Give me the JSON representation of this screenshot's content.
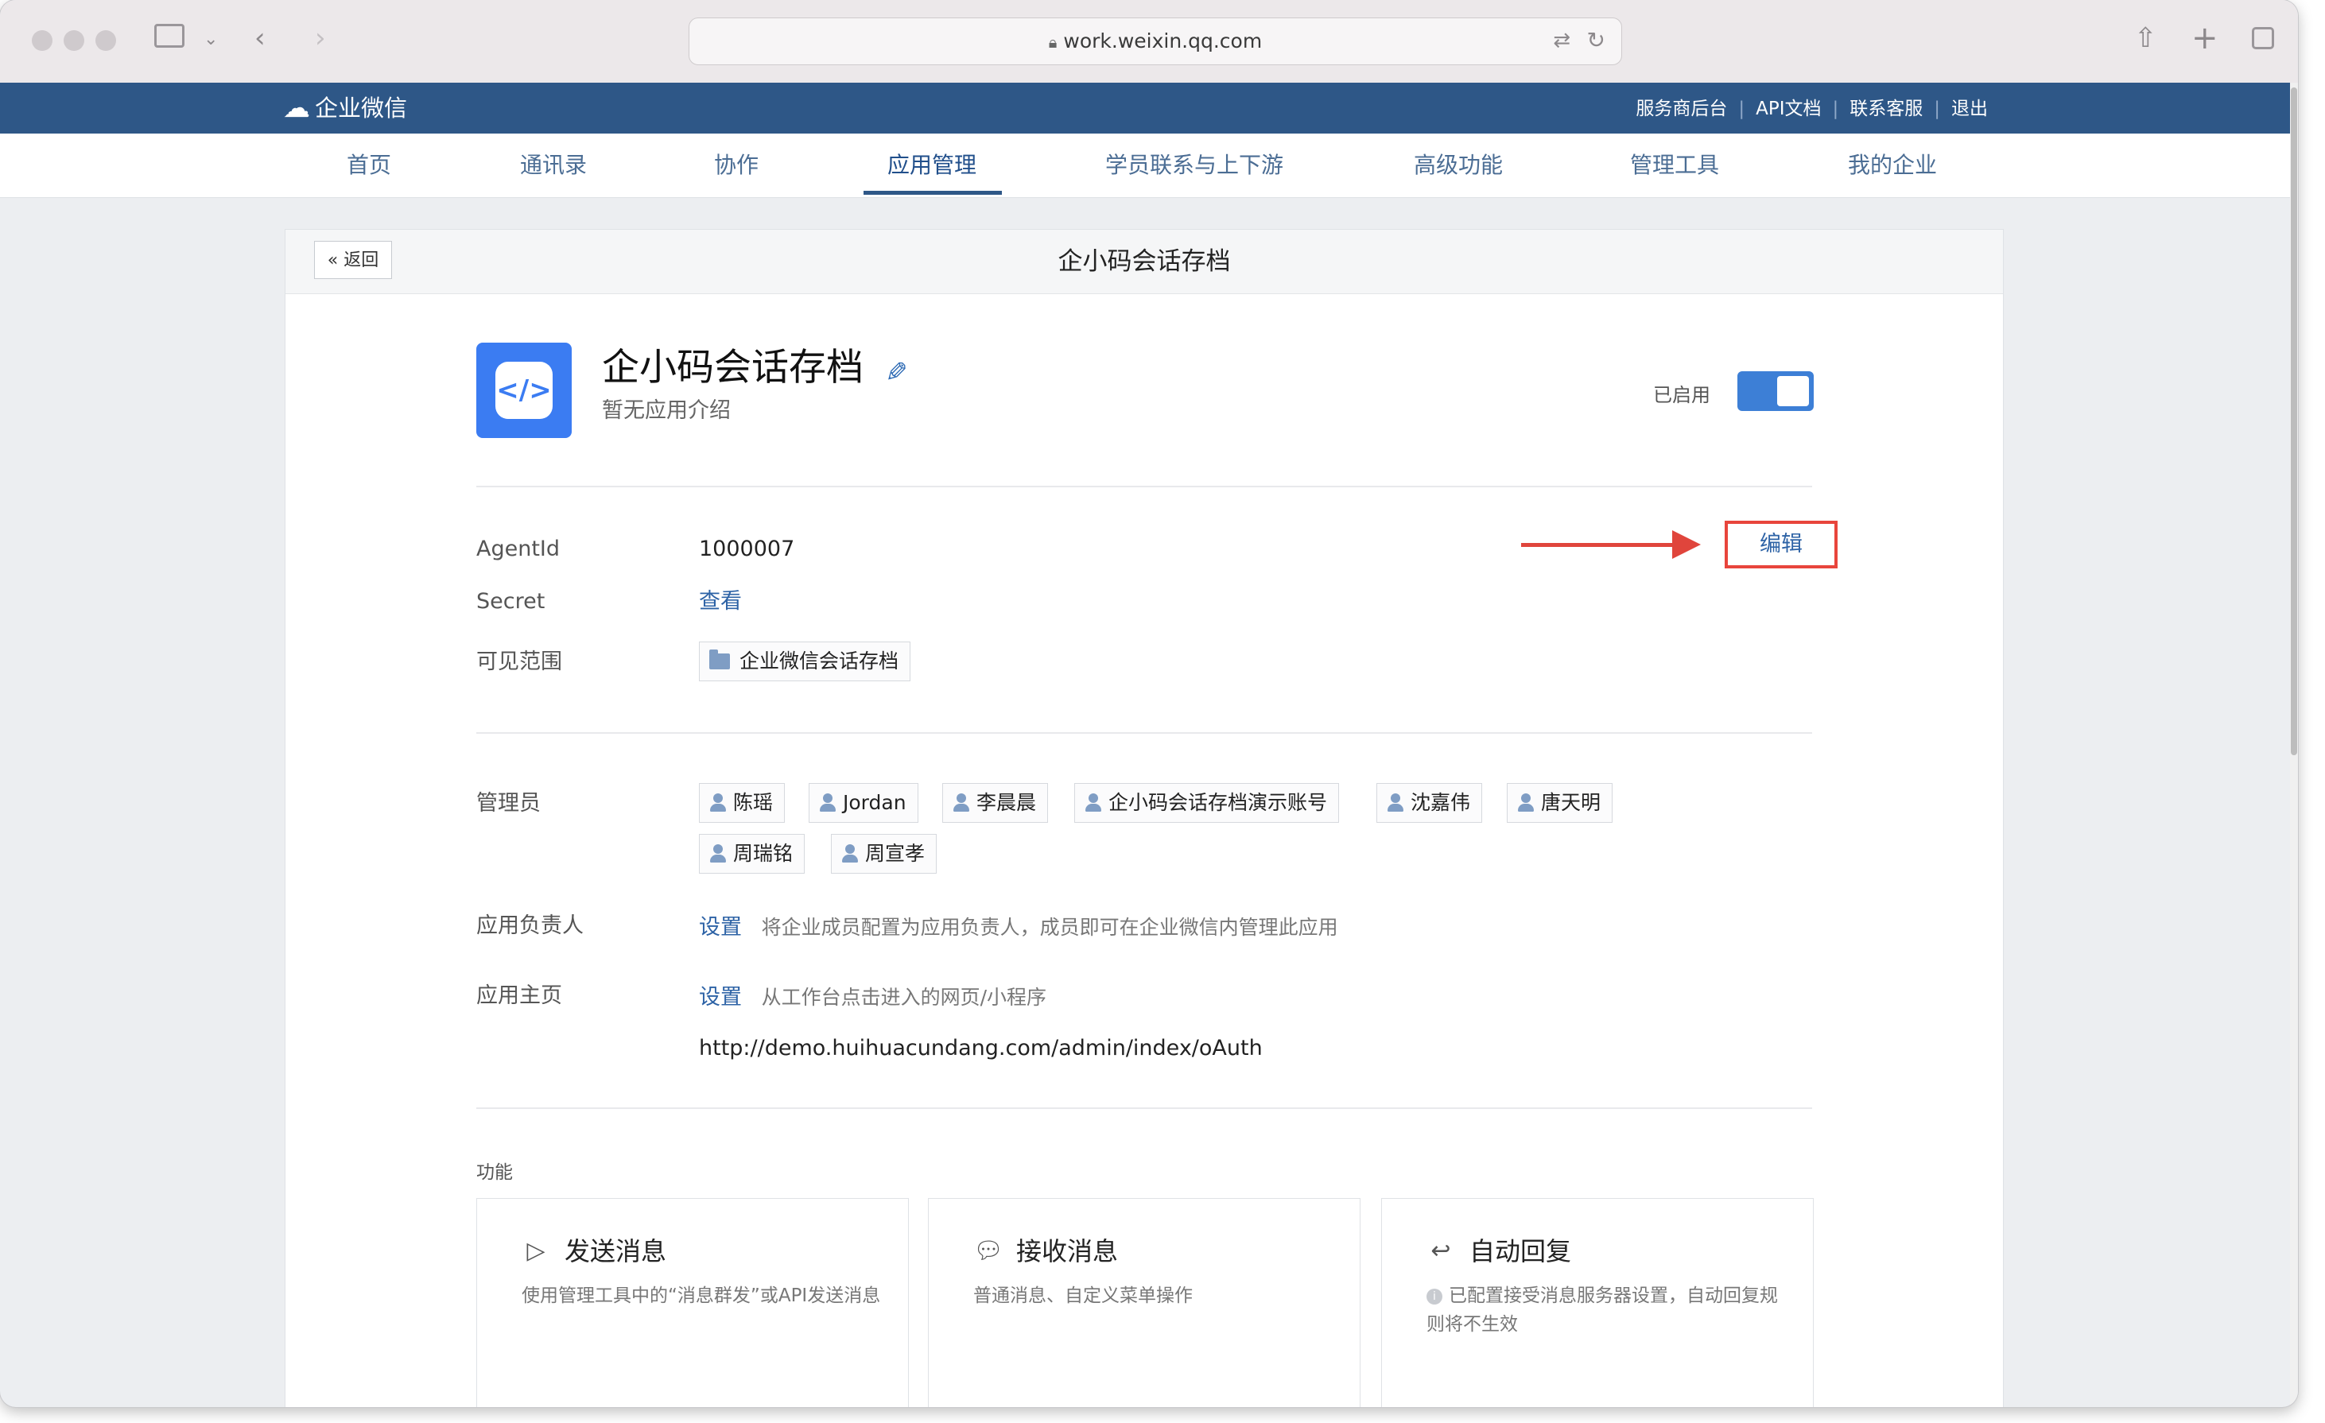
{
  "browser": {
    "url": "work.weixin.qq.com"
  },
  "topbar": {
    "logo": "企业微信",
    "links": [
      "服务商后台",
      "API文档",
      "联系客服",
      "退出"
    ]
  },
  "nav": {
    "items": [
      "首页",
      "通讯录",
      "协作",
      "应用管理",
      "学员联系与上下游",
      "高级功能",
      "管理工具",
      "我的企业"
    ],
    "active": "应用管理"
  },
  "card": {
    "back": "返回",
    "title": "企小码会话存档"
  },
  "app": {
    "name": "企小码会话存档",
    "desc": "暂无应用介绍",
    "status_label": "已启用",
    "enabled": true,
    "edit": "编辑"
  },
  "fields": {
    "agentid_label": "AgentId",
    "agentid_value": "1000007",
    "secret_label": "Secret",
    "secret_link": "查看",
    "scope_label": "可见范围",
    "scope_value": "企业微信会话存档"
  },
  "admins": {
    "label": "管理员",
    "people": [
      "陈瑶",
      "Jordan",
      "李晨晨",
      "企小码会话存档演示账号",
      "沈嘉伟",
      "唐天明",
      "周瑞铭",
      "周宣孝"
    ]
  },
  "owner": {
    "label": "应用负责人",
    "link": "设置",
    "hint": "将企业成员配置为应用负责人，成员即可在企业微信内管理此应用"
  },
  "homepage": {
    "label": "应用主页",
    "link": "设置",
    "hint": "从工作台点击进入的网页/小程序",
    "url": "http://demo.huihuacundang.com/admin/index/oAuth"
  },
  "features": {
    "title": "功能",
    "cards": [
      {
        "icon": "send-icon",
        "title": "发送消息",
        "desc": "使用管理工具中的“消息群发”或API发送消息"
      },
      {
        "icon": "chat-bubble-icon",
        "title": "接收消息",
        "desc": "普通消息、自定义菜单操作"
      },
      {
        "icon": "reply-icon",
        "title": "自动回复",
        "desc": "已配置接受消息服务器设置，自动回复规则将不生效"
      }
    ]
  }
}
